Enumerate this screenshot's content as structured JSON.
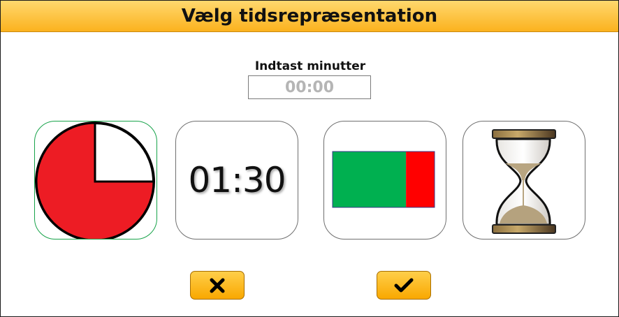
{
  "dialog": {
    "title": "Vælg tidsrepræsentation"
  },
  "minutes": {
    "label": "Indtast minutter",
    "value": "",
    "placeholder": "00:00"
  },
  "options": [
    {
      "id": "pie-timer",
      "icon": "pie-timer-icon",
      "selected": true,
      "remaining_fraction": 0.75,
      "color": "#ed1c24"
    },
    {
      "id": "digital-clock",
      "icon": "digital-clock-icon",
      "selected": false,
      "time_text": "01:30"
    },
    {
      "id": "progress-bar",
      "icon": "progress-bar-icon",
      "selected": false,
      "remaining_fraction": 0.72,
      "remaining_color": "#00b050",
      "elapsed_color": "#ff0000"
    },
    {
      "id": "hourglass",
      "icon": "hourglass-icon",
      "selected": false
    }
  ],
  "buttons": {
    "cancel_icon": "close-icon",
    "confirm_icon": "checkmark-icon"
  }
}
